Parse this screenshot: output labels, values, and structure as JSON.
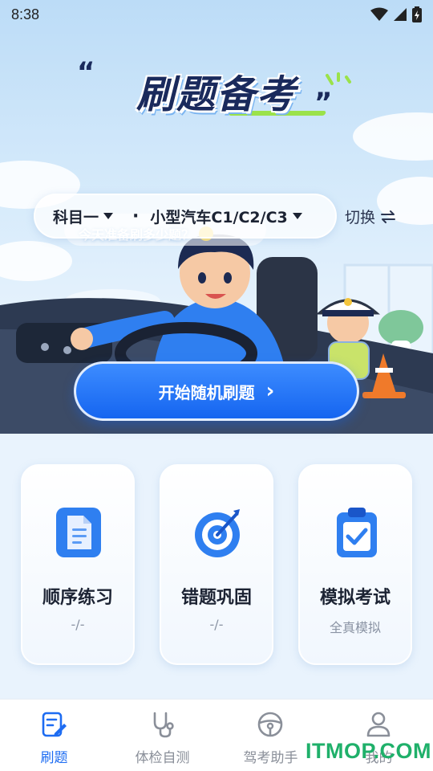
{
  "status_bar": {
    "time": "8:38"
  },
  "hero": {
    "title": "刷题备考",
    "open_quote": "“",
    "close_quote": "”",
    "speech_bubble": "今天准备刷多少题？"
  },
  "selector": {
    "subject": "科目一",
    "separator": "·",
    "license": "小型汽车C1/C2/C3",
    "switch_label": "切换",
    "switch_icon": "swap-arrows-icon"
  },
  "cta": {
    "label": "开始随机刷题",
    "arrow": "›"
  },
  "cards": [
    {
      "title": "顺序练习",
      "subtitle": "-/-",
      "icon": "document-icon"
    },
    {
      "title": "错题巩固",
      "subtitle": "-/-",
      "icon": "target-icon"
    },
    {
      "title": "模拟考试",
      "subtitle": "全真模拟",
      "icon": "clipboard-check-icon"
    }
  ],
  "tabbar": {
    "active_index": 0,
    "tabs": [
      {
        "label": "刷题",
        "icon": "edit-note-icon"
      },
      {
        "label": "体检自测",
        "icon": "stethoscope-icon"
      },
      {
        "label": "驾考助手",
        "icon": "steering-wheel-icon"
      },
      {
        "label": "我的",
        "icon": "person-icon"
      }
    ]
  },
  "watermark": {
    "part1": "IT",
    "part2": "MO",
    "part3": "P",
    "part4": ".COM"
  },
  "colors": {
    "primary": "#1d6cf2",
    "title": "#1a2a5c",
    "accent_green": "#9be24a",
    "muted": "#8a93a3"
  }
}
